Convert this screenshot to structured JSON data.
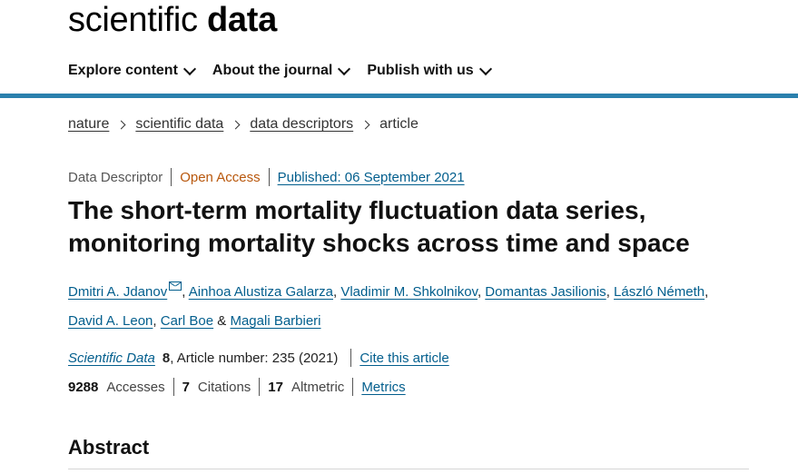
{
  "brand": {
    "light": "scientific",
    "bold": "data"
  },
  "nav": {
    "items": [
      {
        "label": "Explore content"
      },
      {
        "label": "About the journal"
      },
      {
        "label": "Publish with us"
      }
    ]
  },
  "breadcrumb": {
    "items": [
      "nature",
      "scientific data",
      "data descriptors"
    ],
    "current": "article"
  },
  "article": {
    "type": "Data Descriptor",
    "access": "Open Access",
    "published": "Published: 06 September 2021",
    "title_line1": "The short-term mortality fluctuation data series,",
    "title_line2": "monitoring mortality shocks across time and space",
    "authors": [
      "Dmitri A. Jdanov",
      "Ainhoa Alustiza Galarza",
      "Vladimir M. Shkolnikov",
      "Domantas Jasilionis",
      "László Németh",
      "David A. Leon",
      "Carl Boe",
      "Magali Barbieri"
    ],
    "author_joiner": "&",
    "journal": "Scientific Data",
    "volume": "8",
    "article_number": ", Article number: 235 (2021)",
    "cite_label": "Cite this article",
    "accesses_count": "9288",
    "accesses_label": "Accesses",
    "citations_count": "7",
    "citations_label": "Citations",
    "altmetric_count": "17",
    "altmetric_label": "Altmetric",
    "metrics_label": "Metrics"
  },
  "section": {
    "abstract": "Abstract"
  },
  "colors": {
    "accent_rule": "#2a80ad",
    "link": "#025e8d",
    "open_access": "#b8570c"
  },
  "icons": {
    "author_contact": "mail-icon",
    "dropdown": "chevron-down-icon",
    "breadcrumb_separator": "chevron-right-icon"
  }
}
